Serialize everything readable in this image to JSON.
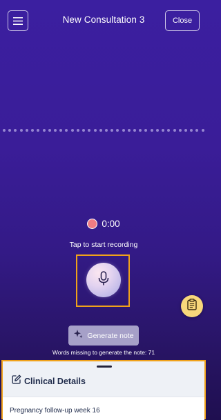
{
  "header": {
    "title": "New Consultation 3",
    "close_label": "Close",
    "menu_icon": "hamburger-menu-icon"
  },
  "recorder": {
    "elapsed": "0:00",
    "instruction": "Tap to start recording",
    "mic_icon": "microphone-icon",
    "status_color": "#f07b83"
  },
  "generate": {
    "label": "Generate note",
    "icon": "sparkle-icon",
    "words_missing_text": "Words missing to generate the note: 71"
  },
  "fab": {
    "icon": "clipboard-icon",
    "color": "#f8d77b"
  },
  "clinical_details": {
    "title": "Clinical Details",
    "icon": "edit-icon",
    "note": "Pregnancy follow-up week 16"
  },
  "colors": {
    "background_top": "#3b1fa0",
    "background_bottom": "#1f0f50",
    "highlight": "#f0a21a",
    "generate_button": "#a6a0c8"
  }
}
